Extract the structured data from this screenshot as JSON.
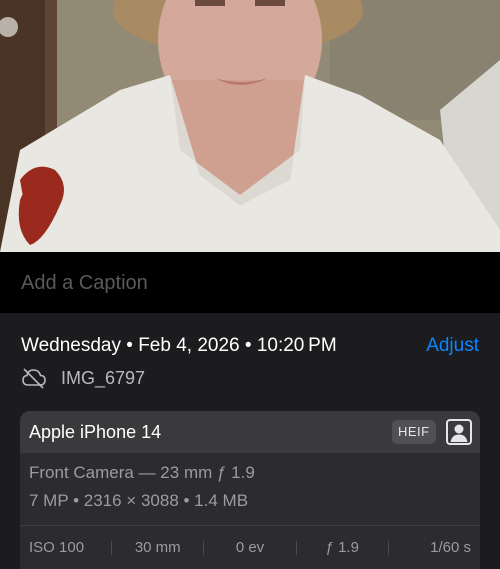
{
  "caption": {
    "placeholder": "Add a Caption"
  },
  "header": {
    "date_time": "Wednesday • Feb 4, 2026 • 10:20 PM",
    "adjust_label": "Adjust"
  },
  "file": {
    "name": "IMG_6797",
    "icon": "cloud-slash-icon"
  },
  "camera": {
    "device": "Apple iPhone 14",
    "format_badge": "HEIF",
    "portrait_icon": "portrait-mode-icon",
    "lens": "Front Camera — 23 mm ƒ 1.9",
    "specs": "7 MP • 2316 × 3088 • 1.4 MB"
  },
  "exif": {
    "iso": "ISO 100",
    "focal": "30 mm",
    "exposure": "0 ev",
    "aperture": "ƒ 1.9",
    "shutter": "1/60 s"
  },
  "colors": {
    "accent": "#0a84ff",
    "background": "#1c1c1e"
  }
}
